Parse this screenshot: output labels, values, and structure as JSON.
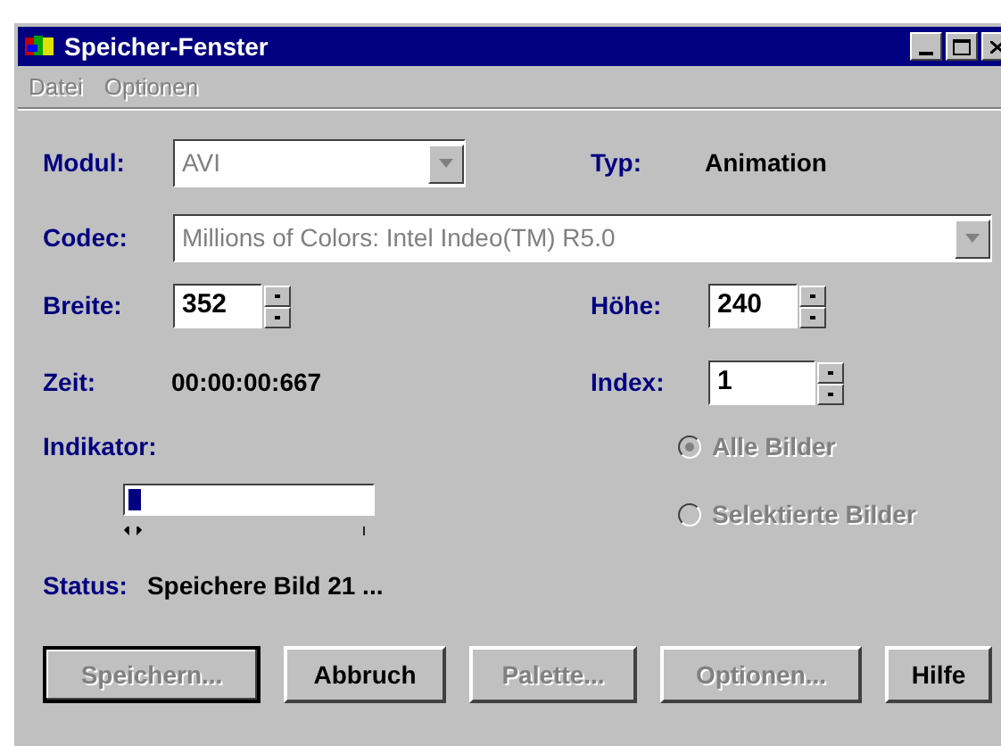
{
  "window": {
    "title": "Speicher-Fenster"
  },
  "menu": [
    {
      "label": "Datei",
      "disabled": true
    },
    {
      "label": "Optionen",
      "disabled": true
    }
  ],
  "modul": {
    "label": "Modul:",
    "value": "AVI",
    "disabled": true
  },
  "typ": {
    "label": "Typ:",
    "value": "Animation"
  },
  "codec": {
    "label": "Codec:",
    "value": "Millions of Colors: Intel Indeo(TM) R5.0",
    "disabled": true
  },
  "breite": {
    "label": "Breite:",
    "value": "352"
  },
  "hoehe": {
    "label": "Höhe:",
    "value": "240"
  },
  "zeit": {
    "label": "Zeit:",
    "value": "00:00:00:667"
  },
  "index": {
    "label": "Index:",
    "value": "1"
  },
  "indikator": {
    "label": "Indikator:",
    "level": 0.05
  },
  "radios": [
    {
      "label": "Alle Bilder",
      "selected": true,
      "disabled": true
    },
    {
      "label": "Selektierte Bilder",
      "selected": false,
      "disabled": true
    }
  ],
  "status": {
    "label": "Status:",
    "value": "Speichere Bild 21 ..."
  },
  "buttons": [
    {
      "label": "Speichern...",
      "disabled": true,
      "default": true
    },
    {
      "label": "Abbruch",
      "disabled": false,
      "default": false
    },
    {
      "label": "Palette...",
      "disabled": true,
      "default": false
    },
    {
      "label": "Optionen...",
      "disabled": true,
      "default": false
    },
    {
      "label": "Hilfe",
      "disabled": false,
      "default": false
    }
  ]
}
